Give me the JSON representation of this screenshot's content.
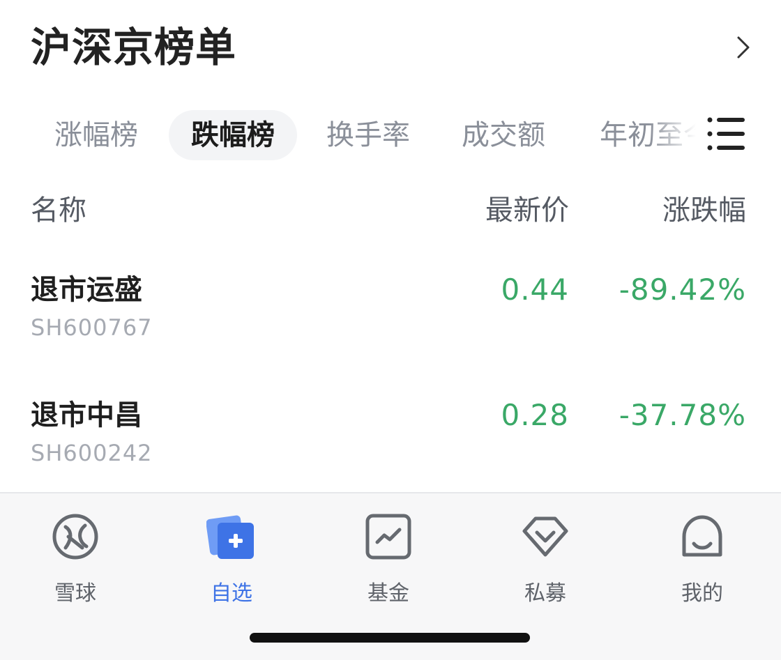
{
  "header": {
    "title": "沪深京榜单"
  },
  "tabs": [
    {
      "label": "涨幅榜"
    },
    {
      "label": "跌幅榜"
    },
    {
      "label": "换手率"
    },
    {
      "label": "成交额"
    },
    {
      "label": "年初至今"
    }
  ],
  "active_tab": "跌幅榜",
  "columns": {
    "name": "名称",
    "price": "最新价",
    "change": "涨跌幅"
  },
  "rows": [
    {
      "name": "退市运盛",
      "code": "SH600767",
      "price": "0.44",
      "change": "-89.42%"
    },
    {
      "name": "退市中昌",
      "code": "SH600242",
      "price": "0.28",
      "change": "-37.78%"
    }
  ],
  "nav": [
    {
      "label": "雪球",
      "icon": "snowball-logo-icon"
    },
    {
      "label": "自选",
      "icon": "watchlist-add-icon"
    },
    {
      "label": "基金",
      "icon": "fund-chart-icon"
    },
    {
      "label": "私募",
      "icon": "private-fund-diamond-icon"
    },
    {
      "label": "我的",
      "icon": "profile-face-icon"
    }
  ],
  "active_nav": "自选",
  "colors": {
    "down_green": "#3aa867",
    "accent_blue": "#3e73e6",
    "text_dark": "#222222",
    "text_gray": "#8a8f99"
  }
}
